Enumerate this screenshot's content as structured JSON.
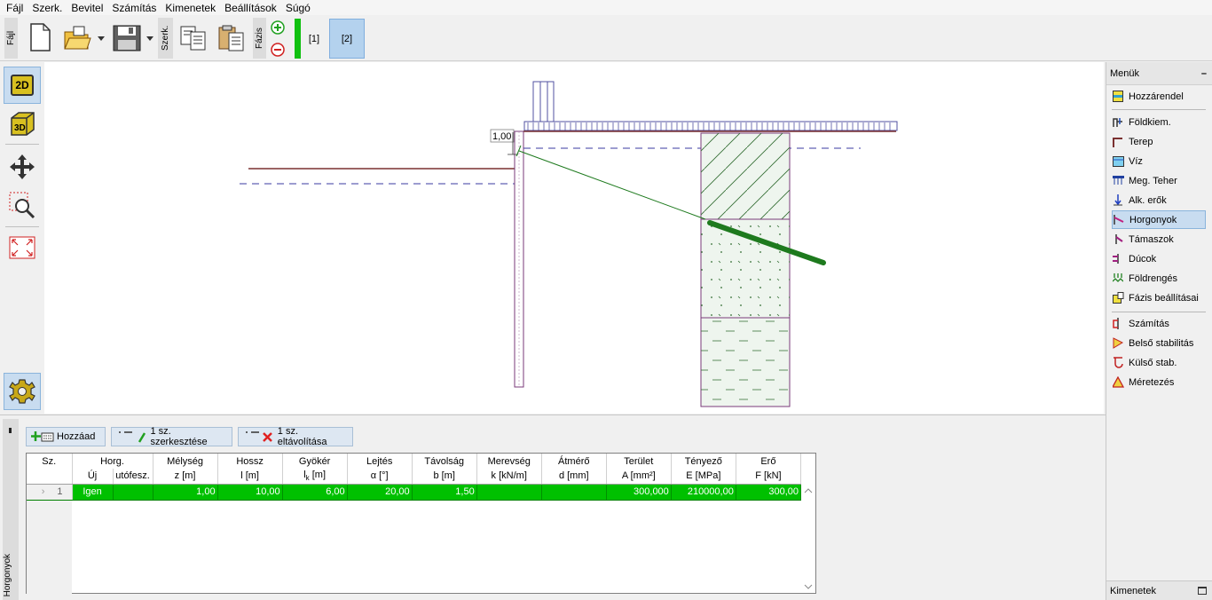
{
  "menu": [
    "Fájl",
    "Szerk.",
    "Bevitel",
    "Számítás",
    "Kimenetek",
    "Beállítások",
    "Súgó"
  ],
  "toolbar": {
    "file_label": "Fájl",
    "edit_label": "Szerk.",
    "phase_label": "Fázis",
    "phases": [
      "[1]",
      "[2]"
    ],
    "active_phase": "[2]"
  },
  "left_tools": {
    "view_2d": "2D",
    "view_3d": "3D"
  },
  "canvas": {
    "dimension_label": "1,00"
  },
  "right_panel": {
    "header": "Menük",
    "items": [
      "Hozzárendel",
      "Földkiem.",
      "Terep",
      "Víz",
      "Meg. Teher",
      "Alk. erők",
      "Horgonyok",
      "Támaszok",
      "Dúcok",
      "Földrengés",
      "Fázis beállításai"
    ],
    "active_item": "Horgonyok",
    "analysis_items": [
      "Számítás",
      "Belső stabilitás",
      "Külső stab.",
      "Méretezés"
    ],
    "footer": "Kimenetek"
  },
  "bottom": {
    "side_label": "Horgonyok",
    "buttons": {
      "add": "Hozzáad",
      "edit": "1 sz. szerkesztése",
      "remove": "1 sz. eltávolítása"
    },
    "table": {
      "headers_top": [
        "Sz.",
        "Horg.",
        "",
        "Mélység",
        "Hossz",
        "Gyökér",
        "Lejtés",
        "Távolság",
        "Merevség",
        "Átmérő",
        "Terület",
        "Tényező",
        "Erő"
      ],
      "headers_bottom": [
        "",
        "Új",
        "utófesz.",
        "z [m]",
        "l [m]",
        "lk [m]",
        "α [°]",
        "b [m]",
        "k [kN/m]",
        "d [mm]",
        "A [mm²]",
        "E [MPa]",
        "F [kN]"
      ],
      "rows": [
        {
          "no": "1",
          "new": "Igen",
          "post": "",
          "depth": "1,00",
          "length": "10,00",
          "root": "6,00",
          "slope": "20,00",
          "spacing": "1,50",
          "stiffness": "",
          "diameter": "",
          "area": "300,000",
          "modulus": "210000,00",
          "force": "300,00"
        }
      ]
    }
  },
  "colors": {
    "selected_row": "#00c000",
    "anchor": "#1e7a1e",
    "active_bg": "#c8dcf0"
  }
}
